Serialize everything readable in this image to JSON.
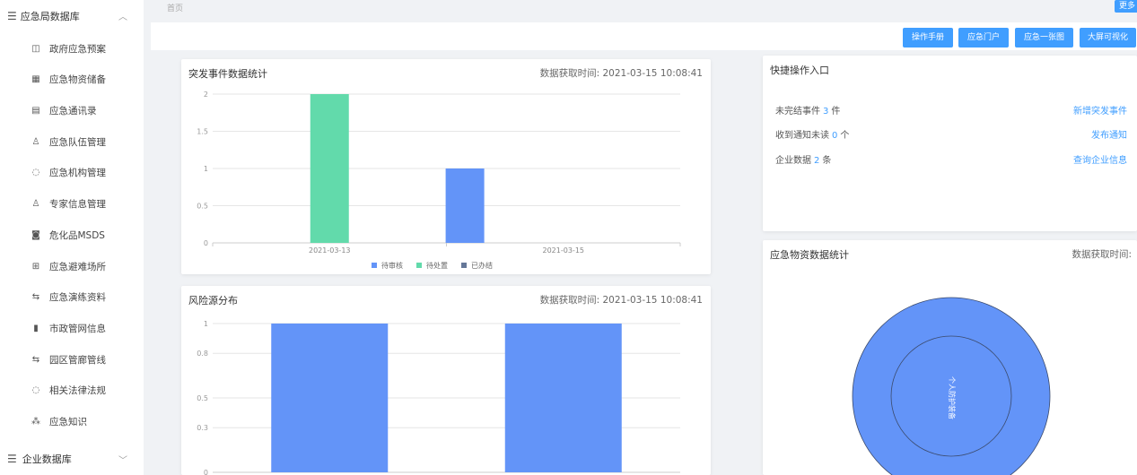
{
  "sidebar": {
    "header": {
      "label": "应急局数据库",
      "icon": "menu-icon",
      "chevron": "chevron-up-icon"
    },
    "items": [
      {
        "label": "政府应急预案",
        "icon": "plan-icon",
        "glyph": "◫"
      },
      {
        "label": "应急物资储备",
        "icon": "storage-icon",
        "glyph": "▦"
      },
      {
        "label": "应急通讯录",
        "icon": "contacts-icon",
        "glyph": "▤"
      },
      {
        "label": "应急队伍管理",
        "icon": "team-icon",
        "glyph": "♙"
      },
      {
        "label": "应急机构管理",
        "icon": "org-icon",
        "glyph": "◌"
      },
      {
        "label": "专家信息管理",
        "icon": "expert-icon",
        "glyph": "♙"
      },
      {
        "label": "危化品MSDS",
        "icon": "chemical-icon",
        "glyph": "◙"
      },
      {
        "label": "应急避难场所",
        "icon": "shelter-icon",
        "glyph": "⊞"
      },
      {
        "label": "应急演练资料",
        "icon": "drill-icon",
        "glyph": "⇆"
      },
      {
        "label": "市政管网信息",
        "icon": "pipe-network-icon",
        "glyph": "▮"
      },
      {
        "label": "园区管廊管线",
        "icon": "corridor-icon",
        "glyph": "⇆"
      },
      {
        "label": "相关法律法规",
        "icon": "law-icon",
        "glyph": "◌"
      },
      {
        "label": "应急知识",
        "icon": "knowledge-icon",
        "glyph": "⁂"
      }
    ],
    "footer": {
      "label": "企业数据库",
      "icon": "menu-icon",
      "chevron": "chevron-down-icon"
    }
  },
  "breadcrumb": "首页",
  "more_label": "更多",
  "toolbar": {
    "buttons": [
      "操作手册",
      "应急门户",
      "应急一张图",
      "大屏可视化"
    ]
  },
  "incident_card": {
    "title": "突发事件数据统计",
    "time_label": "数据获取时间:",
    "time_value": "2021-03-15 10:08:41"
  },
  "risk_card": {
    "title": "风险源分布",
    "time_label": "数据获取时间:",
    "time_value": "2021-03-15 10:08:41"
  },
  "quick_card": {
    "title": "快捷操作入口",
    "rows": [
      {
        "prefix": "未完结事件",
        "count": "3",
        "unit": "件",
        "action": "新增突发事件"
      },
      {
        "prefix": "收到通知未读",
        "count": "0",
        "unit": "个",
        "action": "发布通知"
      },
      {
        "prefix": "企业数据",
        "count": "2",
        "unit": "条",
        "action": "查询企业信息"
      }
    ]
  },
  "supply_card": {
    "title": "应急物资数据统计",
    "time_label": "数据获取时间:"
  },
  "colors": {
    "blue": "#6394f8",
    "green": "#62daab",
    "navy": "#657798",
    "accent": "#409eff"
  },
  "chart_data": [
    {
      "type": "bar",
      "categories": [
        "2021-03-13",
        "2021-03-15"
      ],
      "series": [
        {
          "name": "待审核",
          "values": [
            0,
            1
          ],
          "color": "#6394f8"
        },
        {
          "name": "待处置",
          "values": [
            2,
            0
          ],
          "color": "#62daab"
        },
        {
          "name": "已办结",
          "values": [
            0,
            0
          ],
          "color": "#657798"
        }
      ],
      "ylim": [
        0,
        2
      ],
      "yticks": [
        "0",
        "0.5",
        "1",
        "1.5",
        "2"
      ],
      "legend": "bottom"
    },
    {
      "type": "bar",
      "categories": [
        "",
        ""
      ],
      "values": [
        1,
        1
      ],
      "ylim": [
        0,
        1
      ],
      "yticks": [
        "0",
        "0.3",
        "0.5",
        "0.8",
        "1"
      ],
      "color": "#6394f8"
    },
    {
      "type": "pie",
      "slices": [
        {
          "label": "个人防护装备",
          "value": 1
        }
      ],
      "color": "#6394f8"
    }
  ]
}
